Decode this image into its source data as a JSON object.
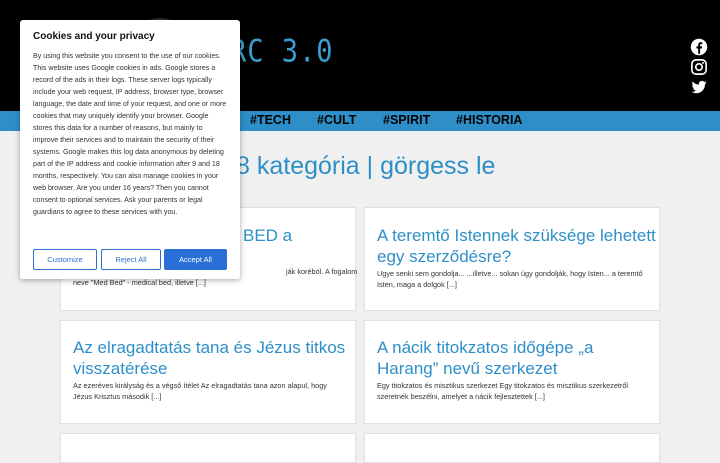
{
  "header": {
    "logo_text": "RC 3.0",
    "social": [
      "facebook-icon",
      "instagram-icon",
      "twitter-icon"
    ]
  },
  "nav": {
    "items": [
      "#TECH",
      "#CULT",
      "#SPIRIT",
      "#HISTORIA"
    ]
  },
  "main": {
    "heading": "8 kategória  | görgess le",
    "cards": [
      {
        "title": "BED a",
        "excerpt_line1": "ják koréból. A fogalom",
        "excerpt_line2": "neve \"Med Bed\" - medical bed, illetve [...]"
      },
      {
        "title": "A teremtő Istennek szüksége lehetett egy szerződésre?",
        "excerpt": "Ugye senki sem gondolja... ...illetve... sokan úgy gondolják, hogy Isten... a teremtő Isten, maga a dolgok [...]"
      },
      {
        "title": "Az elragadtatás tana és Jézus titkos visszatérése",
        "excerpt": "Az ezeréves királyság és a végső ítélet Az elragadtatás tana azon alapul, hogy Jézus Krisztus második [...]"
      },
      {
        "title": "A nácik titokzatos időgépe „a Harang” nevű szerkezet",
        "excerpt": "Egy titokzatos és misztikus szerkezet Egy titokzatos és misztikus szerkezetről szeretnék beszélni, amelyet a nácik fejlesztettek [...]"
      }
    ]
  },
  "cookie": {
    "title": "Cookies and your privacy",
    "body": "By using this website you consent to the use of our cookies. This website uses Google cookies in ads. Google stores a record of the ads in their logs. These server logs typically include your web request, IP address, browser type, browser language, the date and time of your request, and one or more cookies that may uniquely identify your browser. Google stores this data for a number of reasons, but mainly to improve their services and to maintain the security of their systems. Google makes this log data anonymous by deleting part of the IP address and cookie information after 9 and 18 months, respectively. You can also manage cookies in your web browser. Are you under 16 years? Then you cannot consent to optional services. Ask your parents or legal guardians to agree to these services with you.",
    "customize_label": "Customize",
    "reject_label": "Reject All",
    "accept_label": "Accept All"
  },
  "colors": {
    "accent": "#2e8fc8",
    "header_bg": "#000000",
    "button_primary": "#2a6fd8"
  }
}
